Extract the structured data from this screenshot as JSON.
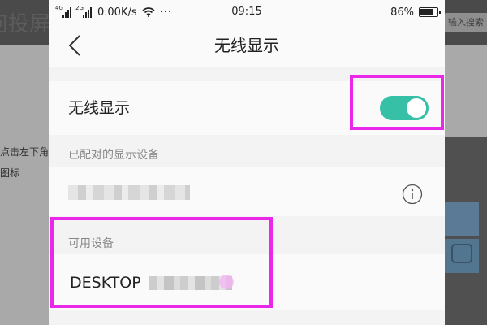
{
  "background": {
    "title": "如何投屏",
    "search_hint": "输入搜索",
    "text_line1": "点击左下角",
    "text_line2": "图标"
  },
  "status_bar": {
    "network_1": "4G",
    "network_2": "2G",
    "speed": "0.00K/s",
    "more": "···",
    "time": "09:15",
    "battery": "86%",
    "battery_level": 0.86
  },
  "nav": {
    "back_icon": "chevron-left-icon",
    "title": "无线显示"
  },
  "toggle": {
    "label": "无线显示",
    "state": "on",
    "color": "#36c0a6"
  },
  "paired": {
    "header": "已配对的显示设备",
    "info_icon": "info-icon"
  },
  "available": {
    "header": "可用设备",
    "device_prefix": "DESKTOP"
  },
  "colors": {
    "highlight": "#ea28ea",
    "toggle_on": "#36c0a6"
  }
}
